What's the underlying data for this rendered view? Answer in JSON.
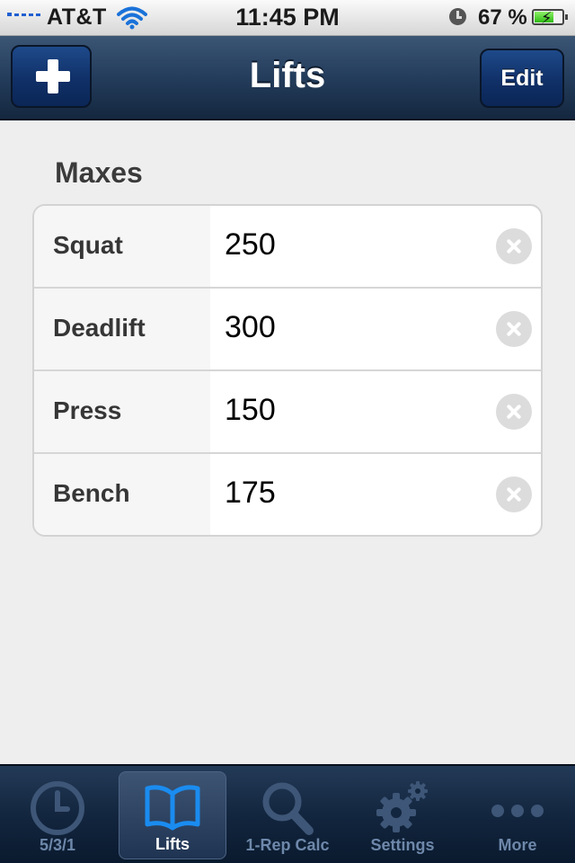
{
  "status_bar": {
    "carrier": "AT&T",
    "time": "11:45 PM",
    "battery_percent": "67 %",
    "battery_level": 0.67,
    "icons": [
      "signal-icon",
      "wifi-icon",
      "alarm-icon",
      "battery-charging-icon"
    ]
  },
  "nav_bar": {
    "title": "Lifts",
    "add_icon": "plus-icon",
    "edit_label": "Edit"
  },
  "maxes": {
    "header": "Maxes",
    "rows": [
      {
        "label": "Squat",
        "value": "250"
      },
      {
        "label": "Deadlift",
        "value": "300"
      },
      {
        "label": "Press",
        "value": "150"
      },
      {
        "label": "Bench",
        "value": "175"
      }
    ],
    "clear_icon": "clear-icon"
  },
  "tab_bar": {
    "tabs": [
      {
        "label": "5/3/1",
        "icon": "clock-icon",
        "active": false
      },
      {
        "label": "Lifts",
        "icon": "book-icon",
        "active": true
      },
      {
        "label": "1-Rep Calc",
        "icon": "search-icon",
        "active": false
      },
      {
        "label": "Settings",
        "icon": "gear-icon",
        "active": false
      },
      {
        "label": "More",
        "icon": "more-icon",
        "active": false
      }
    ]
  },
  "colors": {
    "accent": "#1a8cf0",
    "nav_bar": "#243d5c",
    "background": "#eeeeee"
  }
}
